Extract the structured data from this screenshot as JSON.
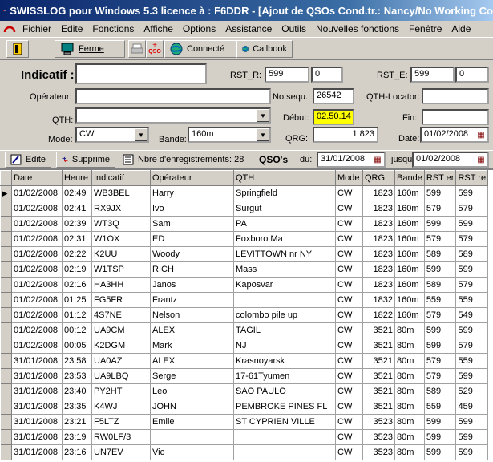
{
  "window": {
    "title": "SWISSLOG pour Windows 5.3 licence à : F6DDR - [Ajout de QSOs  Cond.tr.: Nancy/No Working Co"
  },
  "menu": [
    "Fichier",
    "Edite",
    "Fonctions",
    "Affiche",
    "Options",
    "Assistance",
    "Outils",
    "Nouvelles fonctions",
    "Fenêtre",
    "Aide"
  ],
  "toolbar": {
    "ferme": "Ferme",
    "qso_badge": "QSO",
    "connecte": "Connecté",
    "callbook": "Callbook"
  },
  "form": {
    "indicatif_label": "Indicatif :",
    "indicatif_value": "",
    "rst_r_label": "RST_R:",
    "rst_r_value": "599",
    "rst_r_extra": "0",
    "rst_e_label": "RST_E:",
    "rst_e_value": "599",
    "rst_e_extra": "0",
    "operateur_label": "Opérateur:",
    "operateur_value": "",
    "nosequ_label": "No sequ.:",
    "nosequ_value": "26542",
    "qthloc_label": "QTH-Locator:",
    "qthloc_value": "",
    "qth_label": "QTH:",
    "qth_value": "",
    "debut_label": "Début:",
    "debut_value": "02.50.14",
    "debut_bg": "#ffff00",
    "fin_label": "Fin:",
    "fin_value": "",
    "mode_label": "Mode:",
    "mode_value": "CW",
    "bande_label": "Bande:",
    "bande_value": "160m",
    "qrg_label": "QRG:",
    "qrg_value": "1 823",
    "date_label": "Date:",
    "date_value": "01/02/2008"
  },
  "bar2": {
    "edite": "Edite",
    "supprime": "Supprime",
    "count_text": "Nbre d'enregistrements: 28",
    "qsos_label": "QSO's",
    "du_label": "du:",
    "du_value": "31/01/2008",
    "jusqu_label": "jusqu",
    "jusqu_value": "01/02/2008"
  },
  "table": {
    "headers": [
      "Date",
      "Heure",
      "Indicatif",
      "Opérateur",
      "QTH",
      "Mode",
      "QRG",
      "Bande",
      "RST er",
      "RST re"
    ],
    "rows": [
      [
        "01/02/2008",
        "02:49",
        "WB3BEL",
        "Harry",
        "Springfield",
        "CW",
        "1823",
        "160m",
        "599",
        "599"
      ],
      [
        "01/02/2008",
        "02:41",
        "RX9JX",
        "Ivo",
        "Surgut",
        "CW",
        "1823",
        "160m",
        "579",
        "579"
      ],
      [
        "01/02/2008",
        "02:39",
        "WT3Q",
        "Sam",
        "PA",
        "CW",
        "1823",
        "160m",
        "599",
        "599"
      ],
      [
        "01/02/2008",
        "02:31",
        "W1OX",
        "ED",
        "Foxboro Ma",
        "CW",
        "1823",
        "160m",
        "579",
        "579"
      ],
      [
        "01/02/2008",
        "02:22",
        "K2UU",
        "Woody",
        "LEVITTOWN nr NY",
        "CW",
        "1823",
        "160m",
        "589",
        "589"
      ],
      [
        "01/02/2008",
        "02:19",
        "W1TSP",
        "RICH",
        "Mass",
        "CW",
        "1823",
        "160m",
        "599",
        "599"
      ],
      [
        "01/02/2008",
        "02:16",
        "HA3HH",
        "Janos",
        "Kaposvar",
        "CW",
        "1823",
        "160m",
        "589",
        "579"
      ],
      [
        "01/02/2008",
        "01:25",
        "FG5FR",
        "Frantz",
        "",
        "CW",
        "1832",
        "160m",
        "559",
        "559"
      ],
      [
        "01/02/2008",
        "01:12",
        "4S7NE",
        "Nelson",
        "colombo pile up",
        "CW",
        "1822",
        "160m",
        "579",
        "549"
      ],
      [
        "01/02/2008",
        "00:12",
        "UA9CM",
        "ALEX",
        "TAGIL",
        "CW",
        "3521",
        "80m",
        "599",
        "599"
      ],
      [
        "01/02/2008",
        "00:05",
        "K2DGM",
        "Mark",
        "NJ",
        "CW",
        "3521",
        "80m",
        "599",
        "579"
      ],
      [
        "31/01/2008",
        "23:58",
        "UA0AZ",
        "ALEX",
        " Krasnoyarsk",
        "CW",
        "3521",
        "80m",
        "579",
        "559"
      ],
      [
        "31/01/2008",
        "23:53",
        "UA9LBQ",
        "Serge",
        "17-61Tyumen",
        "CW",
        "3521",
        "80m",
        "579",
        "599"
      ],
      [
        "31/01/2008",
        "23:40",
        "PY2HT",
        "Leo",
        "SAO PAULO",
        "CW",
        "3521",
        "80m",
        "589",
        "529"
      ],
      [
        "31/01/2008",
        "23:35",
        "K4WJ",
        "JOHN",
        "PEMBROKE PINES FL",
        "CW",
        "3521",
        "80m",
        "559",
        "459"
      ],
      [
        "31/01/2008",
        "23:21",
        "F5LTZ",
        "Emile",
        "ST CYPRIEN VILLE",
        "CW",
        "3523",
        "80m",
        "599",
        "599"
      ],
      [
        "31/01/2008",
        "23:19",
        "RW0LF/3",
        "",
        "",
        "CW",
        "3523",
        "80m",
        "599",
        "599"
      ],
      [
        "31/01/2008",
        "23:16",
        "UN7EV",
        "Vic",
        "",
        "CW",
        "3523",
        "80m",
        "599",
        "599"
      ]
    ]
  },
  "icons": {
    "app": "swisslog-logo-icon",
    "door": "door-icon",
    "computer": "computer-icon",
    "printer": "printer-icon",
    "globe": "globe-icon",
    "calendar": "calendar-icon"
  }
}
